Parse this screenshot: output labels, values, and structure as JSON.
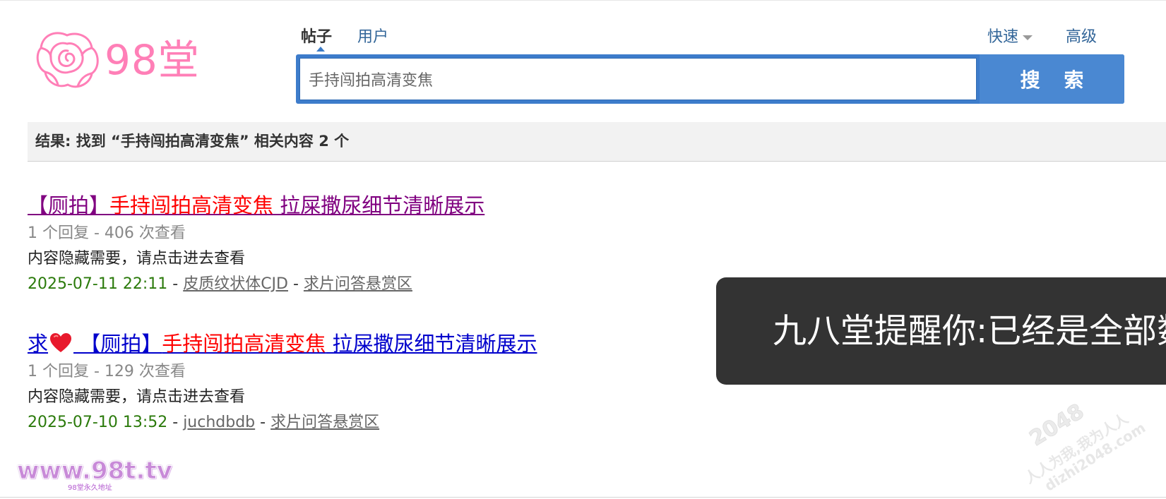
{
  "header": {
    "logo_text": "98堂",
    "brand_color": "#ff7fb7",
    "tabs": [
      {
        "label": "帖子",
        "active": true
      },
      {
        "label": "用户",
        "active": false
      }
    ],
    "quick_label": "快速",
    "advanced_label": "高级"
  },
  "search": {
    "value": "手持闯拍高清变焦",
    "button_label": "搜 索",
    "accent_color": "#3d7ccb"
  },
  "results_bar": {
    "text": "结果: 找到 “手持闯拍高清变焦” 相关内容 2 个"
  },
  "results": [
    {
      "title_prefix": "【厕拍】",
      "title_highlight": "手持闯拍高清变焦",
      "title_suffix": " 拉屎撒尿细节清晰展示",
      "stats": "1 个回复 - 406 次查看",
      "desc": "内容隐藏需要，请点击进去查看",
      "date": "2025-07-11 22:11",
      "author": "皮质纹状体CJD",
      "forum": "求片问答悬赏区",
      "sep": " - "
    },
    {
      "title_lead": "求",
      "heart_icon": "heart-icon",
      "title_prefix": " 【厕拍】",
      "title_highlight": "手持闯拍高清变焦",
      "title_suffix": " 拉屎撒尿细节清晰展示",
      "stats": "1 个回复 - 129 次查看",
      "desc": "内容隐藏需要，请点击进去查看",
      "date": "2025-07-10 13:52",
      "author": "juchdbdb",
      "forum": "求片问答悬赏区",
      "sep": " - "
    }
  ],
  "toast": {
    "text": "九八堂提醒你:已经是全部数"
  },
  "watermarks": {
    "site": "www.98t.tv",
    "site_sub": "98堂永久地址",
    "corner_number": "2048",
    "corner_line1": "人人为我,我为人人",
    "corner_line2": "dizhi2048.com"
  }
}
